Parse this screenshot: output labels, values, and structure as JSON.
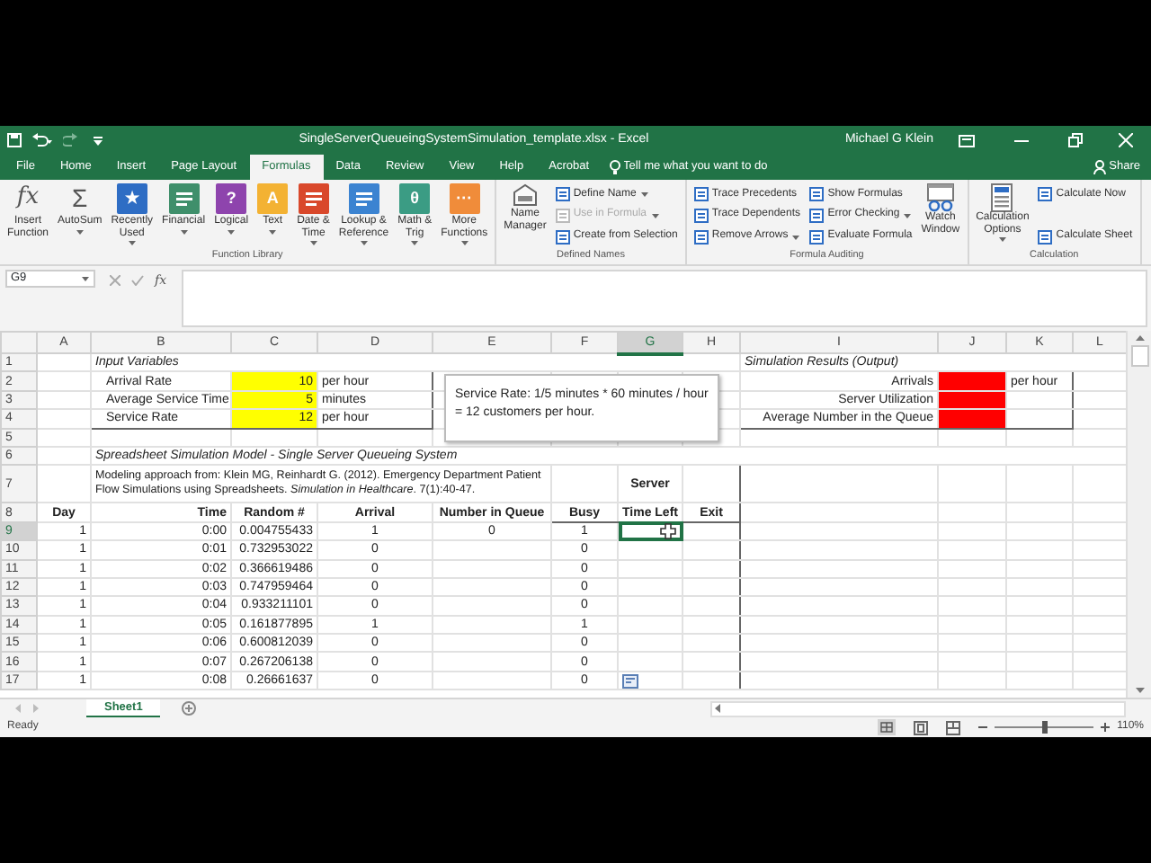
{
  "title_bar": {
    "title": "SingleServerQueueingSystemSimulation_template.xlsx  -  Excel",
    "user": "Michael G Klein"
  },
  "tabs": [
    {
      "label": "File",
      "selected": false
    },
    {
      "label": "Home",
      "selected": false
    },
    {
      "label": "Insert",
      "selected": false
    },
    {
      "label": "Page Layout",
      "selected": false
    },
    {
      "label": "Formulas",
      "selected": true
    },
    {
      "label": "Data",
      "selected": false
    },
    {
      "label": "Review",
      "selected": false
    },
    {
      "label": "View",
      "selected": false
    },
    {
      "label": "Help",
      "selected": false
    },
    {
      "label": "Acrobat",
      "selected": false
    }
  ],
  "tell_me": {
    "placeholder": "Tell me what you want to do"
  },
  "share": "Share",
  "ribbon_groups": [
    {
      "label": "Function Library",
      "items": [
        {
          "kind": "large",
          "lines": [
            "Insert",
            "Function"
          ],
          "glyph": "fx",
          "dropdown": false
        },
        {
          "kind": "large",
          "lines": [
            "AutoSum"
          ],
          "glyph": "Σ",
          "dropdown": true
        },
        {
          "kind": "large",
          "lines": [
            "Recently",
            "Used"
          ],
          "glyph": "★",
          "color": "#2e6dc4",
          "dropdown": true
        },
        {
          "kind": "large",
          "lines": [
            "Financial"
          ],
          "color": "#3f8f6b",
          "dropdown": true
        },
        {
          "kind": "large",
          "lines": [
            "Logical"
          ],
          "glyph": "?",
          "color": "#8e44ad",
          "dropdown": true
        },
        {
          "kind": "large",
          "lines": [
            "Text"
          ],
          "glyph": "A",
          "color": "#f3b233",
          "dropdown": true
        },
        {
          "kind": "large",
          "lines": [
            "Date &",
            "Time"
          ],
          "color": "#d9482b",
          "dropdown": true
        },
        {
          "kind": "large",
          "lines": [
            "Lookup &",
            "Reference"
          ],
          "color": "#3b83d1",
          "dropdown": true
        },
        {
          "kind": "large",
          "lines": [
            "Math &",
            "Trig"
          ],
          "glyph": "θ",
          "color": "#3b9c84",
          "dropdown": true
        },
        {
          "kind": "large",
          "lines": [
            "More",
            "Functions"
          ],
          "glyph": "···",
          "color": "#f08c3a",
          "dropdown": true
        }
      ]
    },
    {
      "label": "Defined Names",
      "items": [
        {
          "kind": "large",
          "lines": [
            "Name",
            "Manager"
          ],
          "dropdown": false
        },
        {
          "kind": "small",
          "label": "Define Name",
          "dropdown": true,
          "disabled": false
        },
        {
          "kind": "small",
          "label": "Use in Formula",
          "dropdown": true,
          "disabled": true
        },
        {
          "kind": "small",
          "label": "Create from Selection",
          "dropdown": false,
          "disabled": false
        }
      ]
    },
    {
      "label": "Formula Auditing",
      "items": [
        {
          "kind": "small",
          "label": "Trace Precedents",
          "dropdown": false,
          "disabled": false
        },
        {
          "kind": "small",
          "label": "Trace Dependents",
          "dropdown": false,
          "disabled": false
        },
        {
          "kind": "small",
          "label": "Remove Arrows",
          "dropdown": true,
          "disabled": false
        },
        {
          "kind": "small",
          "label": "Show Formulas",
          "dropdown": false,
          "disabled": false
        },
        {
          "kind": "small",
          "label": "Error Checking",
          "dropdown": true,
          "disabled": false
        },
        {
          "kind": "small",
          "label": "Evaluate Formula",
          "dropdown": false,
          "disabled": false
        },
        {
          "kind": "large",
          "lines": [
            "Watch",
            "Window"
          ],
          "dropdown": false
        }
      ]
    },
    {
      "label": "Calculation",
      "items": [
        {
          "kind": "large",
          "lines": [
            "Calculation",
            "Options"
          ],
          "dropdown": true
        },
        {
          "kind": "small",
          "label": "Calculate Now",
          "dropdown": false,
          "disabled": false
        },
        {
          "kind": "small",
          "label": "Calculate Sheet",
          "dropdown": false,
          "disabled": false
        }
      ]
    }
  ],
  "formula_bar": {
    "name_box": "G9",
    "function_glyph": "fx"
  },
  "sheet": {
    "columns": [
      {
        "label": "A",
        "selected": false
      },
      {
        "label": "B",
        "selected": false
      },
      {
        "label": "C",
        "selected": false
      },
      {
        "label": "D",
        "selected": false
      },
      {
        "label": "E",
        "selected": false
      },
      {
        "label": "F",
        "selected": false
      },
      {
        "label": "G",
        "selected": true
      },
      {
        "label": "H",
        "selected": false
      },
      {
        "label": "I",
        "selected": false
      },
      {
        "label": "J",
        "selected": false
      },
      {
        "label": "K",
        "selected": false
      },
      {
        "label": "L",
        "selected": false
      }
    ],
    "rows": [
      {
        "label": "1",
        "selected": false,
        "cells": {
          "B": {
            "text": "Input Variables",
            "kind": "heading",
            "merged": true
          },
          "I": {
            "text": "Simulation Results (Output)",
            "kind": "heading",
            "merged": true
          }
        }
      },
      {
        "label": "2",
        "selected": false,
        "cells": {
          "B": {
            "text": "Arrival Rate",
            "kind": "label"
          },
          "C": {
            "text": "10",
            "kind": "number",
            "color": "#ffff00"
          },
          "D": {
            "text": "per hour",
            "kind": "text"
          },
          "I": {
            "text": "Arrivals",
            "kind": "label-right"
          },
          "J": {
            "color": "#ff0000"
          },
          "K": {
            "text": "per hour",
            "kind": "text"
          }
        }
      },
      {
        "label": "3",
        "selected": false,
        "cells": {
          "B": {
            "text": "Average Service Time",
            "kind": "label"
          },
          "C": {
            "text": "5",
            "kind": "number",
            "color": "#ffff00"
          },
          "D": {
            "text": "minutes",
            "kind": "text"
          },
          "I": {
            "text": "Server Utilization",
            "kind": "label-right"
          },
          "J": {
            "color": "#ff0000"
          }
        }
      },
      {
        "label": "4",
        "selected": false,
        "cells": {
          "B": {
            "text": "Service Rate",
            "kind": "label"
          },
          "C": {
            "text": "12",
            "kind": "number",
            "color": "#ffff00"
          },
          "D": {
            "text": "per hour",
            "kind": "text"
          },
          "I": {
            "text": "Average Number in the Queue",
            "kind": "label-right"
          },
          "J": {
            "color": "#ff0000"
          }
        }
      },
      {
        "label": "5",
        "selected": false,
        "cells": {}
      },
      {
        "label": "6",
        "selected": false,
        "cells": {
          "B": {
            "text": "Spreadsheet Simulation Model - Single Server Queueing System",
            "kind": "heading",
            "merged": true
          }
        }
      },
      {
        "label": "7",
        "selected": false,
        "cells": {
          "B": {
            "text": "Modeling approach from: Klein MG, Reinhardt G. (2012). Emergency Department Patient Flow Simulations using Spreadsheets. *Simulation in Healthcare*.  7(1):40-47.",
            "kind": "note",
            "merged": true
          },
          "G": {
            "text": "Server",
            "kind": "header"
          }
        }
      },
      {
        "label": "8",
        "selected": false,
        "cells": {
          "A": {
            "text": "Day",
            "kind": "header"
          },
          "B": {
            "text": "Time",
            "kind": "header-right"
          },
          "C": {
            "text": "Random #",
            "kind": "header"
          },
          "D": {
            "text": "Arrival",
            "kind": "header"
          },
          "E": {
            "text": "Number in Queue",
            "kind": "header"
          },
          "F": {
            "text": "Busy",
            "kind": "header"
          },
          "G": {
            "text": "Time Left",
            "kind": "header"
          },
          "H": {
            "text": "Exit",
            "kind": "header"
          }
        }
      },
      {
        "label": "9",
        "selected": true,
        "cells": {
          "A": {
            "text": "1",
            "kind": "number"
          },
          "B": {
            "text": "0:00",
            "kind": "number"
          },
          "C": {
            "text": "0.004755433",
            "kind": "number"
          },
          "D": {
            "text": "1",
            "kind": "value"
          },
          "E": {
            "text": "0",
            "kind": "value"
          },
          "F": {
            "text": "1",
            "kind": "value"
          },
          "G": {
            "selected": true
          }
        }
      },
      {
        "label": "10",
        "selected": false,
        "cells": {
          "A": {
            "text": "1",
            "kind": "number"
          },
          "B": {
            "text": "0:01",
            "kind": "number"
          },
          "C": {
            "text": "0.732953022",
            "kind": "number"
          },
          "D": {
            "text": "0",
            "kind": "value"
          },
          "F": {
            "text": "0",
            "kind": "value"
          }
        }
      },
      {
        "label": "11",
        "selected": false,
        "cells": {
          "A": {
            "text": "1",
            "kind": "number"
          },
          "B": {
            "text": "0:02",
            "kind": "number"
          },
          "C": {
            "text": "0.366619486",
            "kind": "number"
          },
          "D": {
            "text": "0",
            "kind": "value"
          },
          "F": {
            "text": "0",
            "kind": "value"
          }
        }
      },
      {
        "label": "12",
        "selected": false,
        "cells": {
          "A": {
            "text": "1",
            "kind": "number"
          },
          "B": {
            "text": "0:03",
            "kind": "number"
          },
          "C": {
            "text": "0.747959464",
            "kind": "number"
          },
          "D": {
            "text": "0",
            "kind": "value"
          },
          "F": {
            "text": "0",
            "kind": "value"
          }
        }
      },
      {
        "label": "13",
        "selected": false,
        "cells": {
          "A": {
            "text": "1",
            "kind": "number"
          },
          "B": {
            "text": "0:04",
            "kind": "number"
          },
          "C": {
            "text": "0.933211101",
            "kind": "number"
          },
          "D": {
            "text": "0",
            "kind": "value"
          },
          "F": {
            "text": "0",
            "kind": "value"
          }
        }
      },
      {
        "label": "14",
        "selected": false,
        "cells": {
          "A": {
            "text": "1",
            "kind": "number"
          },
          "B": {
            "text": "0:05",
            "kind": "number"
          },
          "C": {
            "text": "0.161877895",
            "kind": "number"
          },
          "D": {
            "text": "1",
            "kind": "value"
          },
          "F": {
            "text": "1",
            "kind": "value"
          }
        }
      },
      {
        "label": "15",
        "selected": false,
        "cells": {
          "A": {
            "text": "1",
            "kind": "number"
          },
          "B": {
            "text": "0:06",
            "kind": "number"
          },
          "C": {
            "text": "0.600812039",
            "kind": "number"
          },
          "D": {
            "text": "0",
            "kind": "value"
          },
          "F": {
            "text": "0",
            "kind": "value"
          }
        }
      },
      {
        "label": "16",
        "selected": false,
        "cells": {
          "A": {
            "text": "1",
            "kind": "number"
          },
          "B": {
            "text": "0:07",
            "kind": "number"
          },
          "C": {
            "text": "0.267206138",
            "kind": "number"
          },
          "D": {
            "text": "0",
            "kind": "value"
          },
          "F": {
            "text": "0",
            "kind": "value"
          }
        }
      },
      {
        "label": "17",
        "selected": false,
        "cells": {
          "A": {
            "text": "1",
            "kind": "number"
          },
          "B": {
            "text": "0:08",
            "kind": "number"
          },
          "C": {
            "text": "0.26661637",
            "kind": "number"
          },
          "D": {
            "text": "0",
            "kind": "value"
          },
          "F": {
            "text": "0",
            "kind": "value"
          },
          "G": {
            "kind": "paste-options"
          }
        }
      }
    ],
    "text_box": {
      "text": "Service Rate: 1/5 minutes * 60 minutes / hour = 12 customers per hour."
    }
  },
  "sheet_tabs": [
    {
      "label": "Sheet1",
      "selected": true
    }
  ],
  "status_bar": {
    "status": "Ready",
    "zoom": {
      "level": 0.5,
      "reading": "110%"
    }
  }
}
